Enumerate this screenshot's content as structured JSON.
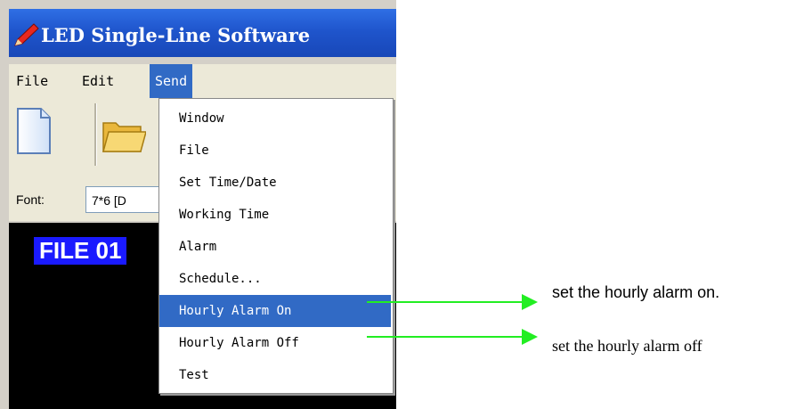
{
  "window": {
    "title": "LED Single-Line Software",
    "menubar": {
      "file": "File",
      "edit": "Edit",
      "send": "Send"
    },
    "fontbar": {
      "label": "Font:",
      "value": "7*6 [D"
    },
    "preview": {
      "text": "FILE 01"
    }
  },
  "send_menu": {
    "items": [
      "Window",
      "File",
      "Set Time/Date",
      "Working Time",
      "Alarm",
      "Schedule...",
      "Hourly Alarm On",
      "Hourly Alarm Off",
      "Test"
    ],
    "highlighted_index": 6
  },
  "annotations": {
    "alarm_on": "set the hourly alarm on.",
    "alarm_off": "set the hourly alarm off"
  },
  "colors": {
    "menu_highlight": "#316ac5",
    "arrow": "#22ee22",
    "titlebar": "#1f55cc"
  }
}
